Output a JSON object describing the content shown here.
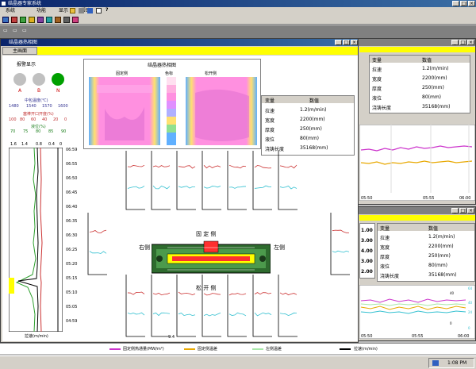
{
  "app": {
    "title": "结晶器专家系统",
    "min": "_",
    "max": "□",
    "close": "×"
  },
  "menu": [
    "系统",
    "功能",
    "显示",
    "帮助",
    "?"
  ],
  "mdi": {
    "minimized": [
      "▭",
      "▭",
      "▭"
    ]
  },
  "colors": {
    "accent": "#0a246a",
    "yellow": "#ffff00",
    "green_lamp": "#00a000",
    "magenta": "#cc33cc",
    "orange": "#e8a800",
    "red": "#cc3333",
    "cyan": "#33c0d0"
  },
  "thermal": {
    "title": "结晶器热相图",
    "tab": "主画面",
    "alarm_label": "报警显示",
    "lamps": [
      {
        "label": "A",
        "state": "off"
      },
      {
        "label": "B",
        "state": "off"
      },
      {
        "label": "N",
        "state": "on"
      }
    ],
    "scale1": {
      "label": "中包温度(℃)",
      "ticks": [
        "1480",
        "1540",
        "1570",
        "1600"
      ]
    },
    "scale2": {
      "label": "塞棒开口开度(%)",
      "ticks": [
        "100",
        "80",
        "60",
        "40",
        "20",
        "0"
      ]
    },
    "scale3": {
      "label": "液位(%)",
      "ticks": [
        "70",
        "75",
        "80",
        "85",
        "90"
      ]
    },
    "trend_top_ticks": [
      "1.6",
      "1.4",
      "0.8",
      "0.4",
      "0"
    ],
    "trend_xlabel": "拉速(m/min)",
    "trend_times": [
      "06:59",
      "06:55",
      "06:50",
      "06:45",
      "06:40",
      "06:35",
      "06:30",
      "06:25",
      "05:20",
      "05:15",
      "05:10",
      "05:05",
      "04:59"
    ],
    "map_title": "结晶器热相图",
    "map_labels": [
      "固定侧",
      "色标",
      "松开侧"
    ],
    "table_head": [
      "变量",
      "数值"
    ],
    "table_rows": [
      [
        "拉速",
        "1.2(m/min)"
      ],
      [
        "宽度",
        "2200(mm)"
      ],
      [
        "厚度",
        "250(mm)"
      ],
      [
        "液位",
        "80(mm)"
      ],
      [
        "浇铸长度",
        "35168(mm)"
      ]
    ],
    "fixed_side": "固 定 侧",
    "loose_side": "松 开 侧",
    "right_side": "右侧",
    "left_side": "左侧",
    "bottom_tick": "9:4",
    "mold_label": "35168"
  },
  "bgwin1": {
    "table_head": [
      "变量",
      "数值"
    ],
    "table_rows": [
      [
        "拉速",
        "1.2(m/min)"
      ],
      [
        "宽度",
        "2200(mm)"
      ],
      [
        "厚度",
        "250(mm)"
      ],
      [
        "液位",
        "80(mm)"
      ],
      [
        "浇铸长度",
        "35168(mm)"
      ]
    ],
    "times": [
      "05:50",
      "05:55",
      "06:00"
    ]
  },
  "bgwin2": {
    "table_head": [
      "变量",
      "数值"
    ],
    "table_rows": [
      [
        "拉速",
        "1.2(m/min)"
      ],
      [
        "宽度",
        "2200(mm)"
      ],
      [
        "厚度",
        "250(mm)"
      ],
      [
        "液位",
        "80(mm)"
      ],
      [
        "浇铸长度",
        "35168(mm)"
      ]
    ],
    "left_vals": [
      "1.00",
      "3.00",
      "4.00",
      "3.00",
      "2.00"
    ],
    "right_ticks": [
      "64",
      "56",
      "48",
      "40",
      "32",
      "24",
      "16",
      "8",
      "0"
    ],
    "left_ticks": [
      "40",
      "30",
      "20",
      "10",
      "0"
    ],
    "times": [
      "05:50",
      "05:55",
      "06:00"
    ]
  },
  "legend": [
    {
      "label": "固定侧热通量(MW/m²)",
      "color": "#cc33cc"
    },
    {
      "label": "固定侧温差",
      "color": "#e8a800"
    },
    {
      "label": "左侧温差",
      "color": "#a8e8a8"
    },
    {
      "label": "拉速(m/min)",
      "color": "#000000"
    }
  ],
  "taskbar": {
    "clock": "1:08 PM"
  }
}
